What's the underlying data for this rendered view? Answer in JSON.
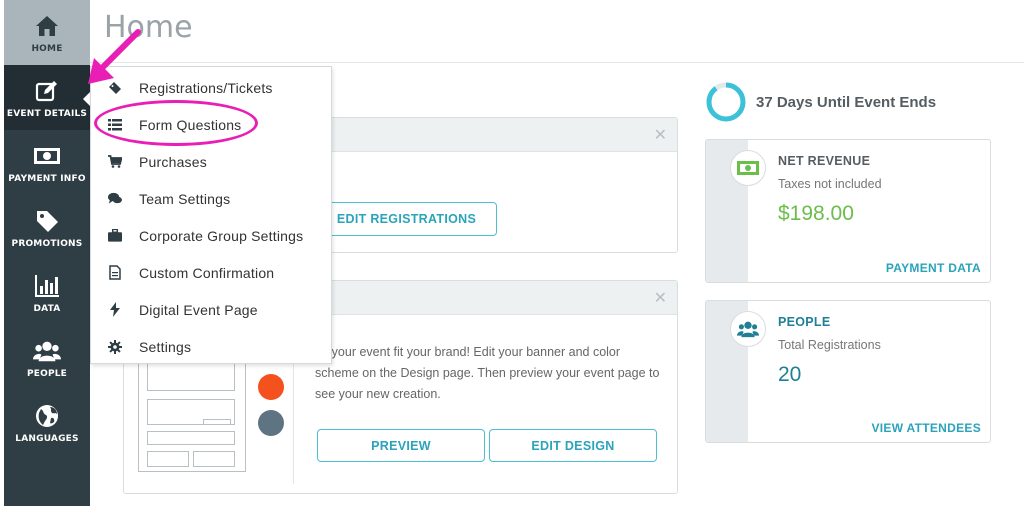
{
  "sidebar": {
    "items": [
      {
        "label": "HOME",
        "icon": "home-icon"
      },
      {
        "label": "EVENT DETAILS",
        "icon": "edit-icon"
      },
      {
        "label": "PAYMENT INFO",
        "icon": "money-icon"
      },
      {
        "label": "PROMOTIONS",
        "icon": "tag-icon"
      },
      {
        "label": "DATA",
        "icon": "bar-chart-icon"
      },
      {
        "label": "PEOPLE",
        "icon": "people-icon"
      },
      {
        "label": "LANGUAGES",
        "icon": "globe-icon"
      }
    ]
  },
  "header": {
    "title": "Home"
  },
  "menu": {
    "items": [
      {
        "label": "Registrations/Tickets",
        "icon": "ticket-icon"
      },
      {
        "label": "Form Questions",
        "icon": "list-icon"
      },
      {
        "label": "Purchases",
        "icon": "cart-icon"
      },
      {
        "label": "Team Settings",
        "icon": "chat-icon"
      },
      {
        "label": "Corporate Group Settings",
        "icon": "briefcase-icon"
      },
      {
        "label": "Custom Confirmation",
        "icon": "document-icon"
      },
      {
        "label": "Digital Event Page",
        "icon": "bolt-icon"
      },
      {
        "label": "Settings",
        "icon": "gear-icon"
      }
    ]
  },
  "registration_card": {
    "edit_label": "EDIT REGISTRATIONS"
  },
  "design_card": {
    "text": "ke your event fit your brand! Edit your banner and color scheme on the Design page. Then preview your event page to see your new creation.",
    "preview_label": "PREVIEW",
    "edit_design_label": "EDIT DESIGN"
  },
  "countdown": {
    "text": "37 Days Until Event Ends"
  },
  "revenue": {
    "title": "NET REVENUE",
    "subtitle": "Taxes not included",
    "value": "$198.00",
    "link": "PAYMENT DATA"
  },
  "people": {
    "title": "PEOPLE",
    "subtitle": "Total Registrations",
    "value": "20",
    "link": "VIEW ATTENDEES"
  },
  "colors": {
    "sidebar_bg": "#2f3e45",
    "accent": "#2aa3bb",
    "revenue_green": "#6bbd4c",
    "people_teal": "#1f7f95",
    "annotation_pink": "#e91eb4",
    "swatch_orange": "#f4511e",
    "swatch_slate": "#5f7482"
  }
}
